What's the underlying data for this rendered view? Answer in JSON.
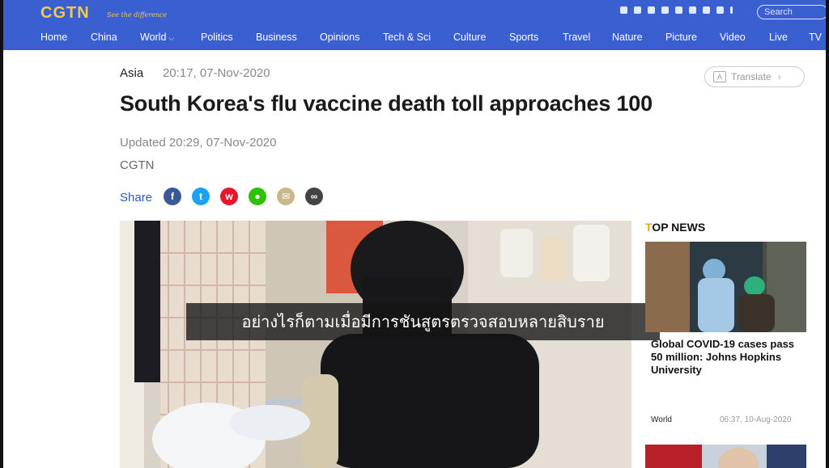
{
  "header": {
    "logo": "CGTN",
    "slogan": "See the difference",
    "search_placeholder": "Search",
    "social_icons": [
      "facebook-icon",
      "twitter-icon",
      "youtube-icon",
      "instagram-icon",
      "weibo-icon",
      "vk-icon",
      "wechat-icon",
      "pinterest-icon",
      "more-icon"
    ]
  },
  "nav": {
    "items": [
      "Home",
      "China",
      "World",
      "Politics",
      "Business",
      "Opinions",
      "Tech & Sci",
      "Culture",
      "Sports",
      "Travel",
      "Nature",
      "Picture",
      "Video",
      "Live",
      "TV"
    ]
  },
  "article": {
    "category": "Asia",
    "timestamp": "20:17, 07-Nov-2020",
    "translate_label": "Translate",
    "headline": "South Korea's flu vaccine death toll approaches 100",
    "updated": "Updated 20:29, 07-Nov-2020",
    "source": "CGTN",
    "share_label": "Share",
    "share_icons": [
      "facebook-icon",
      "twitter-icon",
      "weibo-icon",
      "wechat-icon",
      "email-icon",
      "link-icon"
    ],
    "subtitle_overlay": "อย่างไรก็ตามเมื่อมีการชันสูตรตรวจสอบหลายสิบราย"
  },
  "top_news": {
    "title_first_letter": "T",
    "title_rest": "OP NEWS",
    "headline": "Global COVID-19 cases pass 50 million: Johns Hopkins University",
    "category": "World",
    "date": "06:37, 10-Aug-2020"
  },
  "colors": {
    "brand_blue": "#3a5fd0",
    "logo_gold": "#f2c94c",
    "accent_orange": "#f0a21b",
    "share_blue": "#2f5bbd"
  }
}
